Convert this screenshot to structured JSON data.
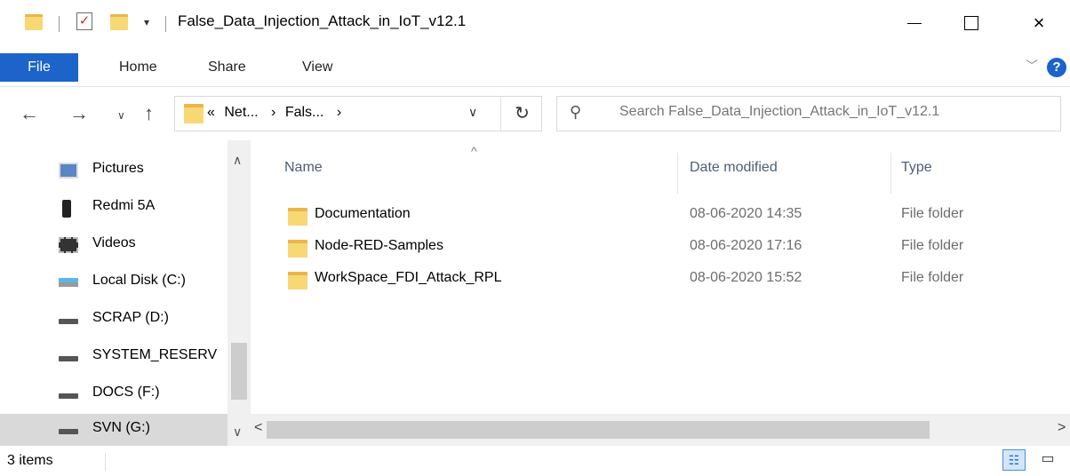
{
  "window": {
    "title": "False_Data_Injection_Attack_in_IoT_v12.1",
    "controls": {
      "minimize": "minimize",
      "maximize": "maximize",
      "close": "×"
    }
  },
  "ribbon": {
    "tabs": [
      "File",
      "Home",
      "Share",
      "View"
    ]
  },
  "address": {
    "overflow": "«",
    "crumbs": [
      "Net...",
      "Fals..."
    ],
    "separator": "›",
    "refresh": "↻"
  },
  "search": {
    "placeholder": "Search False_Data_Injection_Attack_in_IoT_v12.1"
  },
  "sidebar": {
    "items": [
      {
        "label": "Pictures",
        "icon": "pictures-icon"
      },
      {
        "label": "Redmi 5A",
        "icon": "phone-icon"
      },
      {
        "label": "Videos",
        "icon": "videos-icon"
      },
      {
        "label": "Local Disk (C:)",
        "icon": "local-disk-icon"
      },
      {
        "label": "SCRAP (D:)",
        "icon": "drive-icon"
      },
      {
        "label": "SYSTEM_RESERV",
        "icon": "drive-icon"
      },
      {
        "label": "DOCS (F:)",
        "icon": "drive-icon"
      },
      {
        "label": "SVN (G:)",
        "icon": "drive-icon",
        "selected": true
      }
    ]
  },
  "columns": {
    "name": "Name",
    "date": "Date modified",
    "type": "Type"
  },
  "files": [
    {
      "name": "Documentation",
      "date": "08-06-2020 14:35",
      "type": "File folder"
    },
    {
      "name": "Node-RED-Samples",
      "date": "08-06-2020 17:16",
      "type": "File folder"
    },
    {
      "name": "WorkSpace_FDI_Attack_RPL",
      "date": "08-06-2020 15:52",
      "type": "File folder"
    }
  ],
  "status": {
    "item_count": "3 items"
  },
  "colors": {
    "accent": "#1c64c9",
    "folder": "#f8d775",
    "selection": "#d9d9d9"
  }
}
